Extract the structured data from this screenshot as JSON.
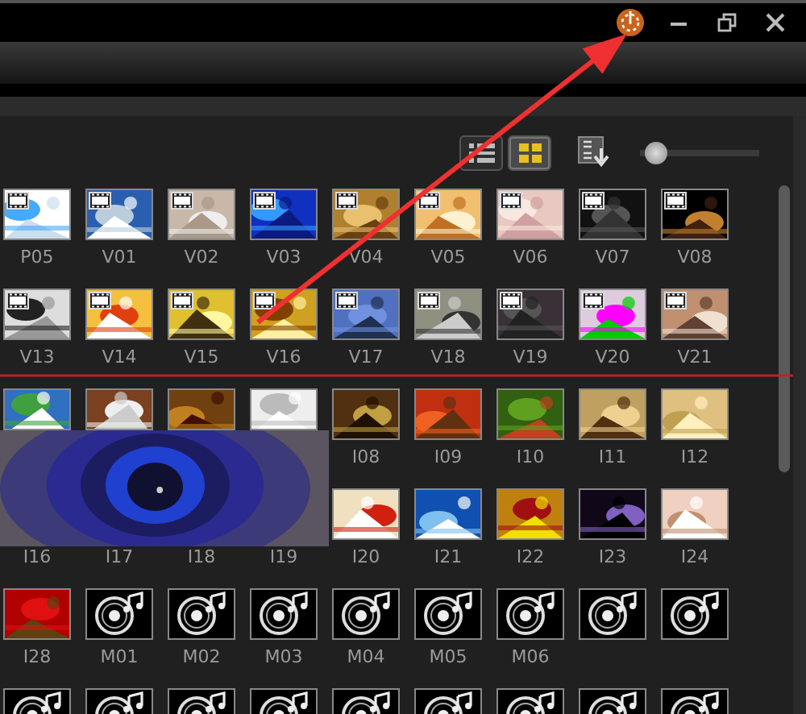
{
  "toolbar": {
    "list_view": {
      "selected": false
    },
    "grid_view": {
      "selected": true
    },
    "zoom_slider": {
      "level": 0.05
    }
  },
  "library": {
    "items": [
      {
        "kind": "video",
        "label": "P05"
      },
      {
        "kind": "video",
        "label": "V01"
      },
      {
        "kind": "video",
        "label": "V02"
      },
      {
        "kind": "video",
        "label": "V03"
      },
      {
        "kind": "video",
        "label": "V04"
      },
      {
        "kind": "video",
        "label": "V05"
      },
      {
        "kind": "video",
        "label": "V06"
      },
      {
        "kind": "video",
        "label": "V07"
      },
      {
        "kind": "video",
        "label": "V08"
      },
      {
        "kind": "video",
        "label": "V13"
      },
      {
        "kind": "video",
        "label": "V14"
      },
      {
        "kind": "video",
        "label": "V15"
      },
      {
        "kind": "video",
        "label": "V16"
      },
      {
        "kind": "video",
        "label": "V17"
      },
      {
        "kind": "video",
        "label": "V18"
      },
      {
        "kind": "video",
        "label": "V19"
      },
      {
        "kind": "video",
        "label": "V20"
      },
      {
        "kind": "video",
        "label": "V21"
      },
      {
        "kind": "partial"
      },
      {
        "kind": "partial"
      },
      {
        "kind": "partial"
      },
      {
        "kind": "partial"
      },
      {
        "label": "I08"
      },
      {
        "label": "I09"
      },
      {
        "label": "I10"
      },
      {
        "label": "I11"
      },
      {
        "label": "I12"
      },
      {
        "kind": "covered",
        "label": "I16"
      },
      {
        "kind": "covered",
        "label": "I17"
      },
      {
        "kind": "covered",
        "label": "I18"
      },
      {
        "kind": "covered",
        "label": "I19"
      },
      {
        "label": "I20"
      },
      {
        "label": "I21"
      },
      {
        "label": "I22"
      },
      {
        "label": "I23"
      },
      {
        "label": "I24"
      },
      {
        "label": "I28"
      },
      {
        "kind": "audio",
        "label": "M01"
      },
      {
        "kind": "audio",
        "label": "M02"
      },
      {
        "kind": "audio",
        "label": "M03"
      },
      {
        "kind": "audio",
        "label": "M04"
      },
      {
        "kind": "audio",
        "label": "M05"
      },
      {
        "kind": "audio",
        "label": "M06"
      },
      {
        "kind": "audio"
      },
      {
        "kind": "audio"
      },
      {
        "kind": "audio"
      },
      {
        "kind": "audio"
      },
      {
        "kind": "audio"
      },
      {
        "kind": "audio"
      },
      {
        "kind": "audio"
      },
      {
        "kind": "audio"
      },
      {
        "kind": "audio"
      },
      {
        "kind": "audio"
      },
      {
        "kind": "audio"
      }
    ]
  }
}
